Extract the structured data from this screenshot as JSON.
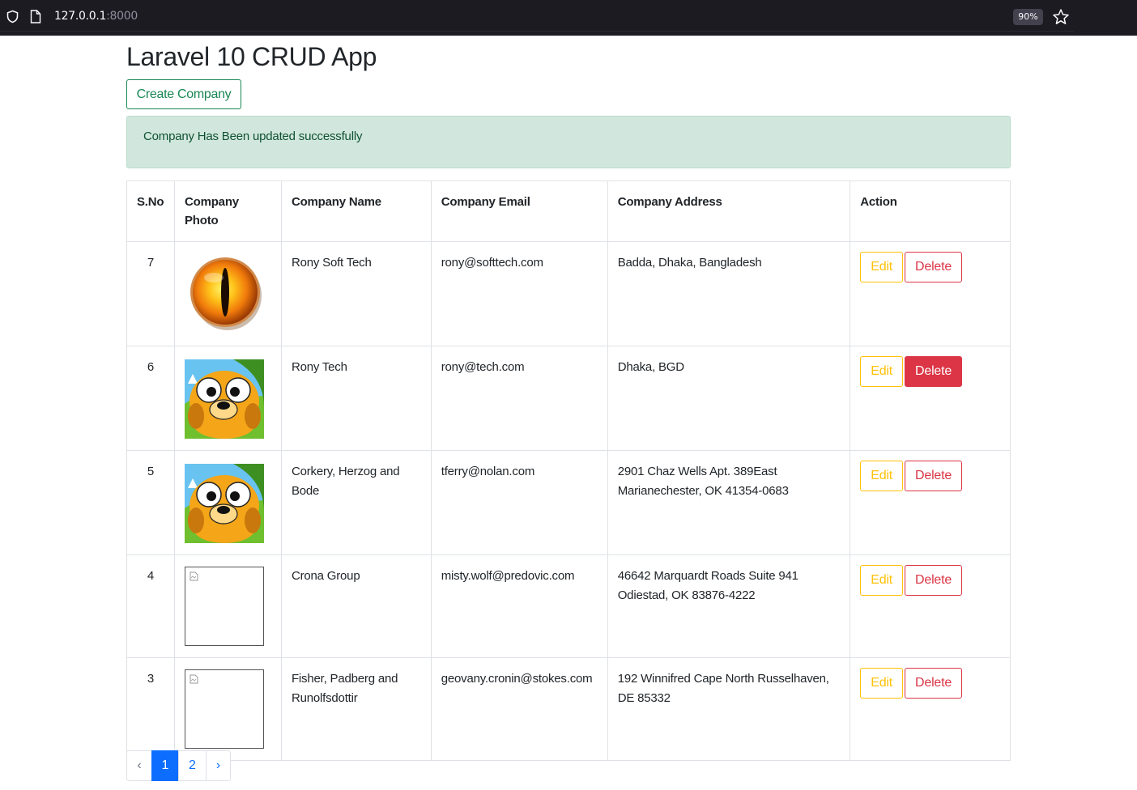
{
  "browser": {
    "url_host": "127.0.0.1",
    "url_port": ":8000",
    "zoom": "90%"
  },
  "page": {
    "title": "Laravel 10 CRUD App",
    "create_button": "Create Company",
    "alert": "Company Has Been updated successfully"
  },
  "table": {
    "headers": {
      "sno": "S.No",
      "photo_line1": "Company",
      "photo_line2": "Photo",
      "name": "Company Name",
      "email": "Company Email",
      "address": "Company Address",
      "action": "Action"
    },
    "edit_label": "Edit",
    "delete_label": "Delete",
    "rows": [
      {
        "sno": "7",
        "photo": "eye",
        "name": "Rony Soft Tech",
        "email": "rony@softtech.com",
        "address": "Badda, Dhaka, Bangladesh"
      },
      {
        "sno": "6",
        "photo": "dog",
        "name": "Rony Tech",
        "email": "rony@tech.com",
        "address": "Dhaka, BGD"
      },
      {
        "sno": "5",
        "photo": "dog",
        "name": "Corkery, Herzog and Bode",
        "email": "tferry@nolan.com",
        "address": "2901 Chaz Wells Apt. 389East Marianechester, OK 41354-0683"
      },
      {
        "sno": "4",
        "photo": "broken",
        "name": "Crona Group",
        "email": "misty.wolf@predovic.com",
        "address": "46642 Marquardt Roads Suite 941 Odiestad, OK 83876-4222"
      },
      {
        "sno": "3",
        "photo": "broken",
        "name": "Fisher, Padberg and Runolfsdottir",
        "email": "geovany.cronin@stokes.com",
        "address": "192 Winnifred Cape North Russelhaven, DE 85332"
      }
    ]
  },
  "pagination": {
    "prev": "‹",
    "pages": [
      "1",
      "2"
    ],
    "current": "1",
    "next": "›"
  },
  "colors": {
    "success": "#198754",
    "warning": "#ffc107",
    "danger": "#dc3545",
    "primary": "#0d6efd"
  }
}
